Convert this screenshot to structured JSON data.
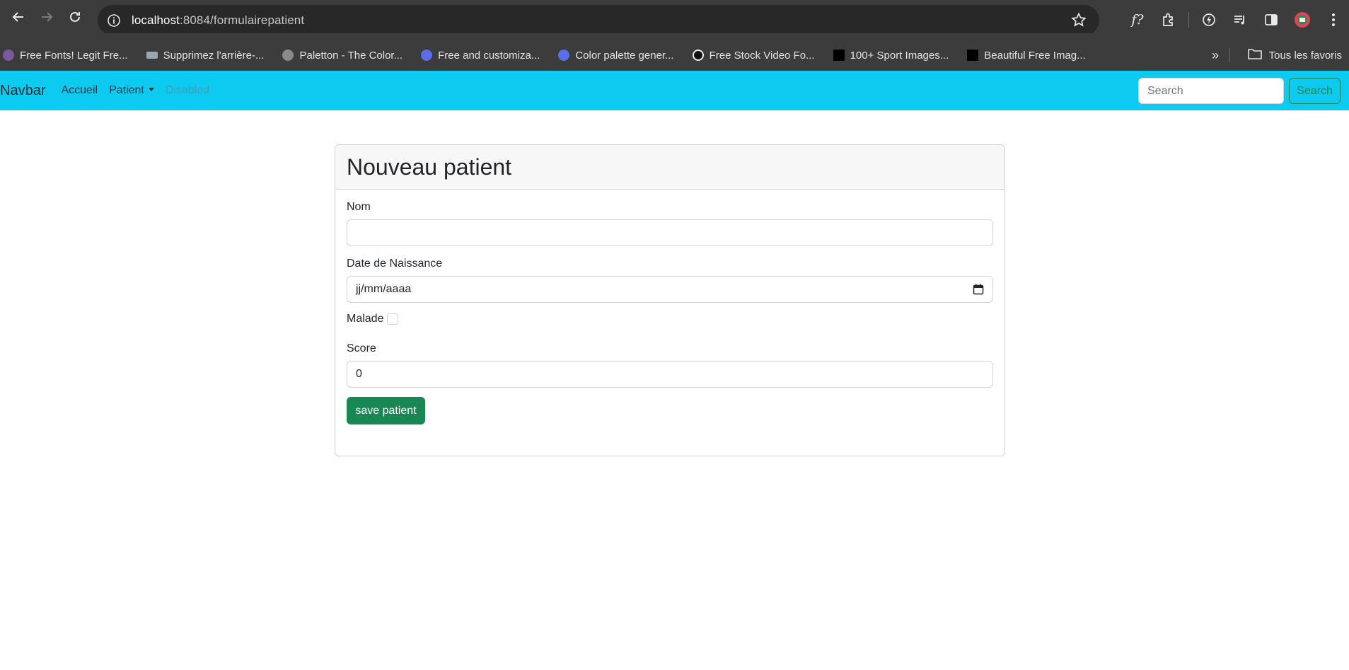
{
  "browser": {
    "url_host": "localhost",
    "url_port_path": ":8084/formulairepatient",
    "bookmarks": [
      {
        "label": "Free Fonts! Legit Fre...",
        "color": "#7a5a9a"
      },
      {
        "label": "Supprimez l'arrière-...",
        "color": "#9aa7b3"
      },
      {
        "label": "Paletton - The Color...",
        "color": "#8a8a8a"
      },
      {
        "label": "Free and customiza...",
        "color": "#5b6ee8"
      },
      {
        "label": "Color palette gener...",
        "color": "#5b6ee8"
      },
      {
        "label": "Free Stock Video Fo...",
        "color": "#111111"
      },
      {
        "label": "100+ Sport Images...",
        "color": "#000000"
      },
      {
        "label": "Beautiful Free Imag...",
        "color": "#000000"
      }
    ],
    "all_bookmarks_label": "Tous les favoris"
  },
  "navbar": {
    "brand": "Navbar",
    "links": {
      "home": "Accueil",
      "patient": "Patient",
      "disabled": "Disabled"
    },
    "search_placeholder": "Search",
    "search_button": "Search",
    "color": "#0dcaf0"
  },
  "form": {
    "title": "Nouveau patient",
    "nom_label": "Nom",
    "nom_value": "",
    "date_label": "Date de Naissance",
    "date_placeholder": "jj/mm/aaaa",
    "malade_label": "Malade",
    "malade_checked": false,
    "score_label": "Score",
    "score_value": "0",
    "save_button": "save patient",
    "save_color": "#198754"
  }
}
